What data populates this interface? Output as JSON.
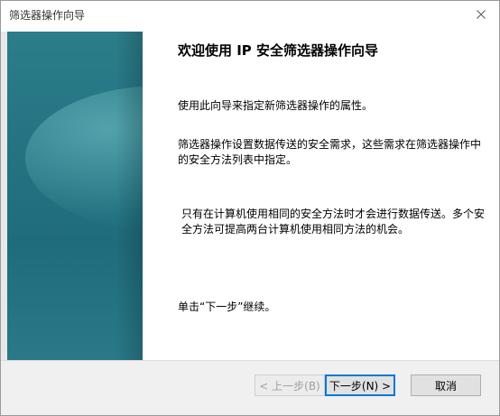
{
  "window": {
    "title": "筛选器操作向导"
  },
  "wizard": {
    "heading": "欢迎使用 IP 安全筛选器操作向导",
    "paragraphs": [
      "使用此向导来指定新筛选器操作的属性。",
      "筛选器操作设置数据传送的安全需求，这些需求在筛选器操作中的安全方法列表中指定。",
      "只有在计算机使用相同的安全方法时才会进行数据传送。多个安全方法可提高两台计算机使用相同方法的机会。",
      "单击“下一步”继续。"
    ]
  },
  "buttons": {
    "back": "< 上一步(B)",
    "next": "下一步(N) >",
    "cancel": "取消"
  },
  "colors": {
    "side_panel": "#247383",
    "accent": "#0078d7"
  },
  "icons": {
    "close": "close-icon"
  }
}
